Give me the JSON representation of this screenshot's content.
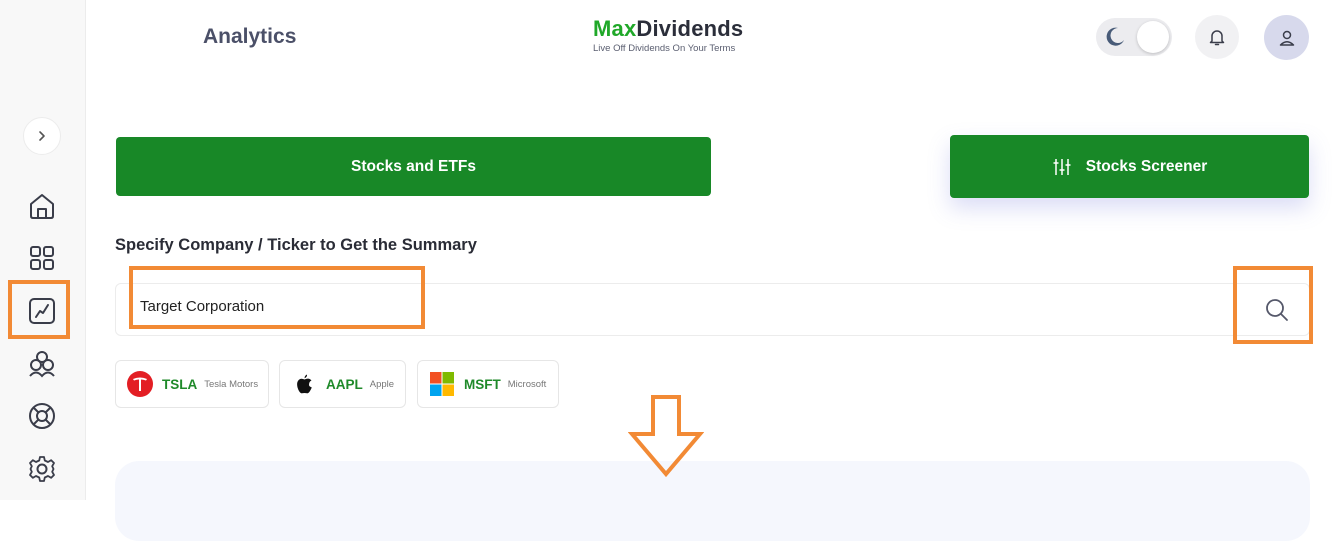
{
  "header": {
    "page_title": "Analytics",
    "logo": {
      "brand_prefix": "Max",
      "brand_suffix": "Dividends",
      "tagline": "Live Off Dividends On Your Terms"
    }
  },
  "sidebar": {
    "items": [
      {
        "name": "home-icon"
      },
      {
        "name": "dashboard-grid-icon"
      },
      {
        "name": "analytics-chart-icon",
        "active": true
      },
      {
        "name": "community-icon"
      },
      {
        "name": "support-lifebuoy-icon"
      },
      {
        "name": "settings-gear-icon"
      }
    ]
  },
  "main": {
    "stocks_button_label": "Stocks and ETFs",
    "screener_button_label": "Stocks Screener",
    "search_label": "Specify Company / Ticker to Get the Summary",
    "search_value": "Target Corporation",
    "quick_picks": [
      {
        "ticker": "TSLA",
        "name": "Tesla Motors"
      },
      {
        "ticker": "AAPL",
        "name": "Apple"
      },
      {
        "ticker": "MSFT",
        "name": "Microsoft"
      }
    ]
  },
  "colors": {
    "brand_green": "#188827",
    "highlight_orange": "#f28a35",
    "logo_green": "#20a829"
  }
}
